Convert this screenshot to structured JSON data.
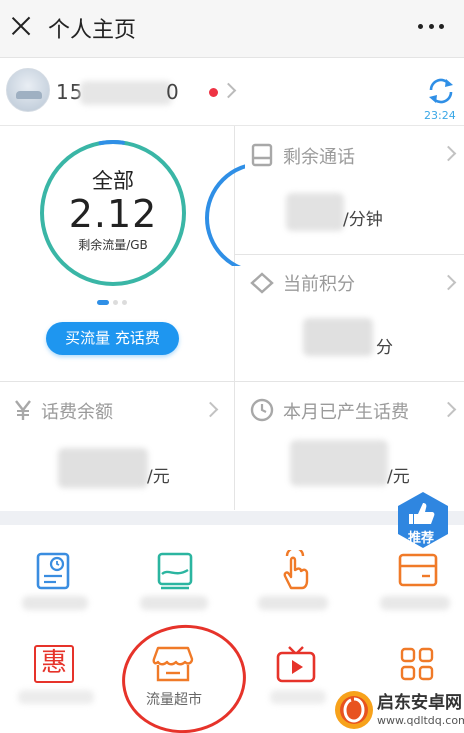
{
  "header": {
    "title": "个人主页",
    "close_icon": "close-icon",
    "more_icon": "more-dots-icon"
  },
  "user": {
    "phone_prefix": "15",
    "phone_suffix": "0",
    "refresh_time": "23:24",
    "refresh_icon": "refresh-icon",
    "alert_color": "#ee3344"
  },
  "data_usage": {
    "label": "全部",
    "value": "2.12",
    "unit_label": "剩余流量/GB",
    "remaining_fraction": 0.95,
    "accent_color": "#2f8fe6",
    "ring_color": "#3ab6a6"
  },
  "buy_button": {
    "label": "买流量 充话费"
  },
  "cells": {
    "calls": {
      "title": "剩余通话",
      "unit": "/分钟",
      "icon": "phone-icon"
    },
    "points": {
      "title": "当前积分",
      "unit": "分",
      "icon": "diamond-icon"
    },
    "balance": {
      "title": "话费余额",
      "unit": "/元",
      "icon": "yen-icon"
    },
    "monthly_fee": {
      "title": "本月已产生话费",
      "unit": "/元",
      "icon": "clock-icon"
    }
  },
  "recommend_badge": {
    "label": "推荐",
    "icon": "thumbs-up-icon"
  },
  "services": [
    {
      "icon": "bill-icon",
      "label": ""
    },
    {
      "icon": "landscape-card-icon",
      "label": ""
    },
    {
      "icon": "tap-hand-icon",
      "label": ""
    },
    {
      "icon": "wallet-card-icon",
      "label": ""
    },
    {
      "icon": "hui-icon",
      "icon_text": "惠",
      "label": ""
    },
    {
      "icon": "store-icon",
      "label": "流量超市"
    },
    {
      "icon": "tv-play-icon",
      "label": ""
    },
    {
      "icon": "apps-grid-icon",
      "label": ""
    }
  ],
  "watermark": {
    "title": "启东安卓网",
    "url": "www.qdltdq.com"
  },
  "colors": {
    "brand_blue": "#1e96f0",
    "icon_blue": "#3a8de0",
    "icon_green": "#2bb5a0",
    "icon_orange": "#f07a28",
    "icon_red": "#e6332a",
    "highlight_red": "#e6332a"
  }
}
